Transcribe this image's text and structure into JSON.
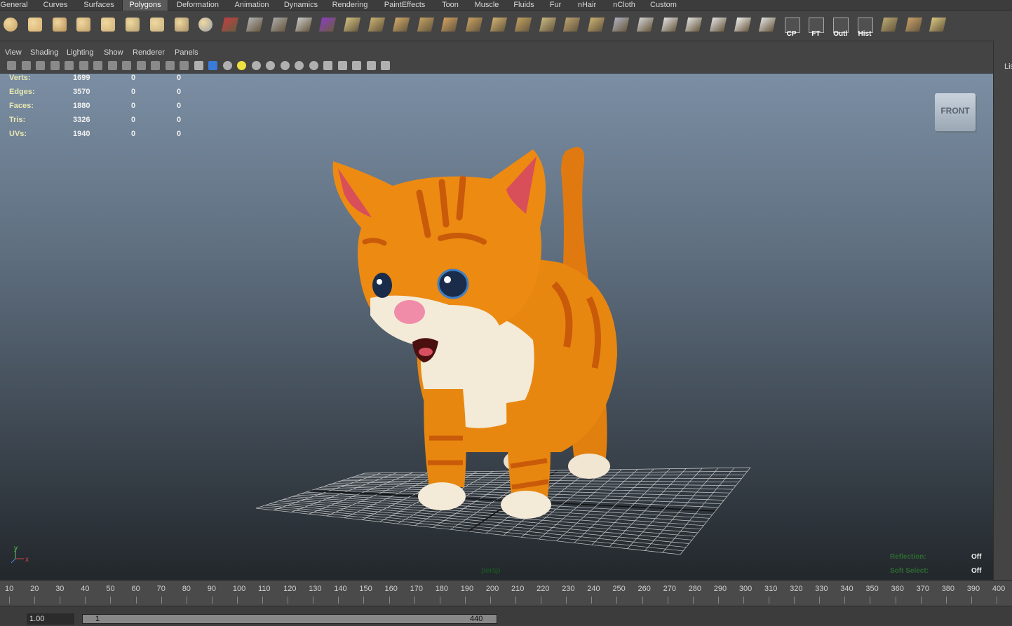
{
  "shelf_tabs": [
    "General",
    "Curves",
    "Surfaces",
    "Polygons",
    "Deformation",
    "Animation",
    "Dynamics",
    "Rendering",
    "PaintEffects",
    "Toon",
    "Muscle",
    "Fluids",
    "Fur",
    "nHair",
    "nCloth",
    "Custom"
  ],
  "active_tab": "Polygons",
  "shelf_icons": [
    {
      "name": "poly-sphere-icon"
    },
    {
      "name": "poly-cube-icon"
    },
    {
      "name": "poly-cylinder-icon"
    },
    {
      "name": "poly-cone-icon"
    },
    {
      "name": "poly-plane-icon"
    },
    {
      "name": "poly-torus-icon"
    },
    {
      "name": "poly-pyramid-icon"
    },
    {
      "name": "poly-pipe-icon"
    },
    {
      "name": "poly-soccer-icon"
    },
    {
      "name": "separate-icon"
    },
    {
      "name": "combine-icon"
    },
    {
      "name": "smooth-icon"
    },
    {
      "name": "average-icon"
    },
    {
      "name": "selected-cube-icon"
    },
    {
      "name": "extrude-icon"
    },
    {
      "name": "bridge-icon"
    },
    {
      "name": "append-icon"
    },
    {
      "name": "split-icon"
    },
    {
      "name": "insert-loop-icon"
    },
    {
      "name": "offset-loop-icon"
    },
    {
      "name": "wedge-icon"
    },
    {
      "name": "poke-icon"
    },
    {
      "name": "bevel-icon"
    },
    {
      "name": "merge-icon"
    },
    {
      "name": "collapse-icon"
    },
    {
      "name": "soften-icon"
    },
    {
      "name": "harden-icon"
    },
    {
      "name": "uv-planar-icon"
    },
    {
      "name": "uv-cyl-icon"
    },
    {
      "name": "uv-sphere-icon"
    },
    {
      "name": "uv-auto-icon"
    },
    {
      "name": "checker-icon"
    },
    {
      "name": "cp-icon",
      "label": "CP"
    },
    {
      "name": "ft-icon",
      "label": "FT"
    },
    {
      "name": "outliner-icon",
      "label": "Outl"
    },
    {
      "name": "history-icon",
      "label": "Hist"
    },
    {
      "name": "sew-icon"
    },
    {
      "name": "cut-icon"
    },
    {
      "name": "unfold-icon"
    }
  ],
  "panel_menu": [
    "View",
    "Shading",
    "Lighting",
    "Show",
    "Renderer",
    "Panels"
  ],
  "hud_stats": [
    {
      "label": "Verts:",
      "v1": "1699",
      "v2": "0",
      "v3": "0"
    },
    {
      "label": "Edges:",
      "v1": "3570",
      "v2": "0",
      "v3": "0"
    },
    {
      "label": "Faces:",
      "v1": "1880",
      "v2": "0",
      "v3": "0"
    },
    {
      "label": "Tris:",
      "v1": "3326",
      "v2": "0",
      "v3": "0"
    },
    {
      "label": "UVs:",
      "v1": "1940",
      "v2": "0",
      "v3": "0"
    }
  ],
  "view_cube_label": "FRONT",
  "camera_name": "persp",
  "hud_bottom": {
    "reflection_label": "Reflection:",
    "reflection_value": "Off",
    "soft_select_label": "Soft Select:",
    "soft_select_value": "Off"
  },
  "axis": {
    "y": "y",
    "x": "x"
  },
  "right_panel_label": "Lis",
  "timeline_ticks": [
    "10",
    "20",
    "30",
    "40",
    "50",
    "60",
    "70",
    "80",
    "90",
    "100",
    "110",
    "120",
    "130",
    "140",
    "150",
    "160",
    "170",
    "180",
    "190",
    "200",
    "210",
    "220",
    "230",
    "240",
    "250",
    "260",
    "270",
    "280",
    "290",
    "300",
    "310",
    "320",
    "330",
    "340",
    "350",
    "360",
    "370",
    "380",
    "390",
    "400"
  ],
  "range": {
    "current": "1.00",
    "start": "1",
    "end": "440"
  },
  "colors": {
    "hud_value": "#f0f0f0",
    "hud_label": "#e8e8b0",
    "hud_dim": "#1d5c21",
    "viewport_top": "#7b8ea3",
    "viewport_bottom": "#22272b"
  }
}
